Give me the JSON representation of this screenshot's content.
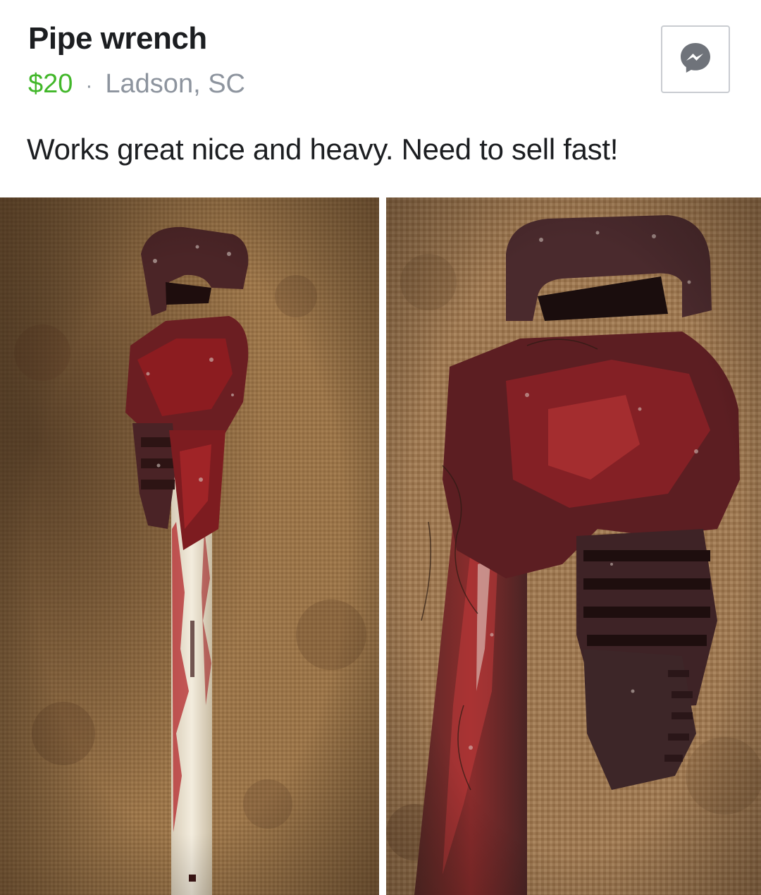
{
  "listing": {
    "title": "Pipe wrench",
    "price": "$20",
    "separator": "·",
    "location": "Ladson, SC",
    "description": "Works great nice and heavy. Need to sell fast!"
  },
  "actions": {
    "message_icon": "messenger-icon"
  },
  "photos": [
    {
      "subject": "bloody pipe wrench on burlap, full view"
    },
    {
      "subject": "bloody pipe wrench on burlap, close-up of jaw"
    }
  ],
  "colors": {
    "title": "#1c1e21",
    "price": "#42b72a",
    "meta": "#8d949e",
    "burlap": "#9c7548",
    "blood": "#7a1212",
    "rust": "#4a2a28"
  }
}
